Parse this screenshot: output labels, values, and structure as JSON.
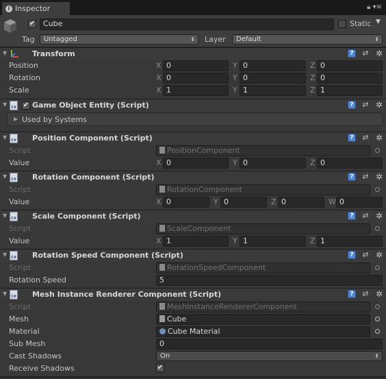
{
  "tab": {
    "label": "Inspector"
  },
  "gameobject": {
    "name": "Cube",
    "static_label": "Static",
    "tag_label": "Tag",
    "tag_value": "Untagged",
    "layer_label": "Layer",
    "layer_value": "Default"
  },
  "transform": {
    "title": "Transform",
    "position_label": "Position",
    "rotation_label": "Rotation",
    "scale_label": "Scale",
    "position": {
      "x": "0",
      "y": "0",
      "z": "0"
    },
    "rotation": {
      "x": "0",
      "y": "0",
      "z": "0"
    },
    "scale": {
      "x": "1",
      "y": "1",
      "z": "1"
    }
  },
  "entity": {
    "title": "Game Object Entity (Script)",
    "foldout_label": "Used by Systems"
  },
  "position_comp": {
    "title": "Position Component (Script)",
    "script_label": "Script",
    "script_value": "PositionComponent",
    "value_label": "Value",
    "x": "0",
    "y": "0",
    "z": "0"
  },
  "rotation_comp": {
    "title": "Rotation Component (Script)",
    "script_label": "Script",
    "script_value": "RotationComponent",
    "value_label": "Value",
    "x": "0",
    "y": "0",
    "z": "0",
    "w": "0"
  },
  "scale_comp": {
    "title": "Scale Component (Script)",
    "script_label": "Script",
    "script_value": "ScaleComponent",
    "value_label": "Value",
    "x": "1",
    "y": "1",
    "z": "1"
  },
  "rotspeed_comp": {
    "title": "Rotation Speed Component (Script)",
    "script_label": "Script",
    "script_value": "RotationSpeedComponent",
    "speed_label": "Rotation Speed",
    "speed_value": "5"
  },
  "mesh_comp": {
    "title": "Mesh Instance Renderer Component (Script)",
    "script_label": "Script",
    "script_value": "MeshInstanceRendererComponent",
    "mesh_label": "Mesh",
    "mesh_value": "Cube",
    "material_label": "Material",
    "material_value": "Cube Material",
    "submesh_label": "Sub Mesh",
    "submesh_value": "0",
    "cast_label": "Cast Shadows",
    "cast_value": "On",
    "receive_label": "Receive Shadows"
  },
  "axis_letters": {
    "x": "X",
    "y": "Y",
    "z": "Z",
    "w": "W"
  },
  "colors": {
    "background": "#383838",
    "field": "#282828",
    "help_icon": "#4f86d4"
  }
}
